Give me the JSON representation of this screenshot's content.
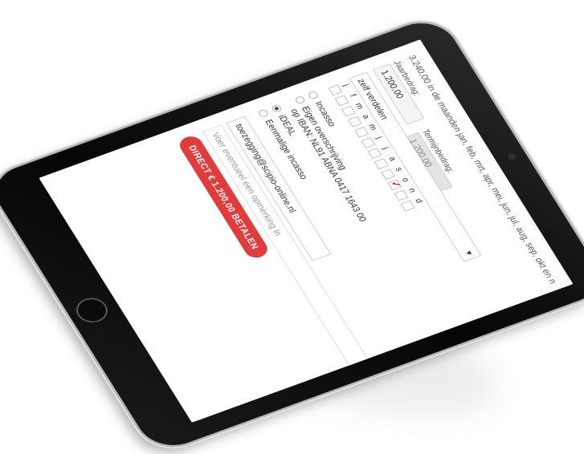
{
  "summary": {
    "amount": "3.240,00",
    "months_text": "in de maanden jan, feb, mrt, apr, mei, jun, jul, aug, sep, okt en n"
  },
  "year_amount": {
    "label": "Jaarbedrag:",
    "value": "1.200,00"
  },
  "term_amount": {
    "label": "Termijnbedrag:",
    "value": "1.200,00"
  },
  "distribution": {
    "selected": "zelf verdelen"
  },
  "months": [
    "j",
    "f",
    "m",
    "a",
    "m",
    "j",
    "j",
    "a",
    "s",
    "o",
    "n",
    "d"
  ],
  "month_checks": [
    false,
    false,
    false,
    false,
    false,
    false,
    false,
    false,
    false,
    true,
    false,
    false
  ],
  "payment_methods": [
    {
      "label": "Incasso",
      "selected": false
    },
    {
      "label": "Eigen overschrijving",
      "sublabel": "op IBAN: NL91 ABNA 0417 1643 00",
      "selected": false
    },
    {
      "label": "iDEAL",
      "selected": true
    },
    {
      "label": "Eenmalige incasso",
      "selected": false
    }
  ],
  "email": {
    "value": "toezegging@scipio-online.nl"
  },
  "remark": {
    "placeholder": "Voer eventueel een opmerking in"
  },
  "pay_button": {
    "label": "DIRECT € 1.200,00 BETALEN"
  },
  "colors": {
    "accent": "#e23b3b",
    "check": "#d32f2f",
    "device": "#0a0a0a"
  }
}
